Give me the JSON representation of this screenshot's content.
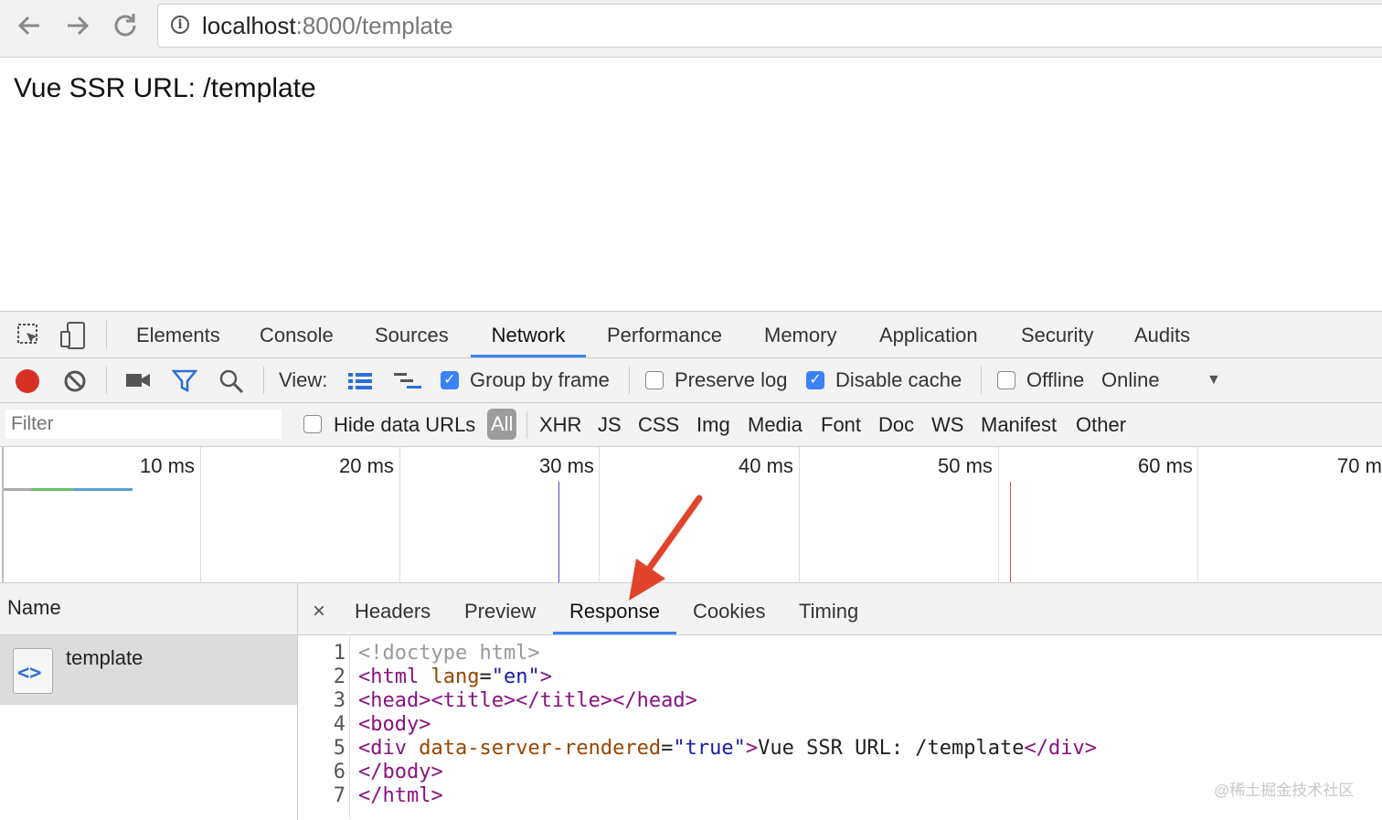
{
  "browser": {
    "url_host": "localhost",
    "url_path": ":8000/template",
    "back_icon": "arrow-left-icon",
    "forward_icon": "arrow-right-icon",
    "reload_icon": "reload-icon"
  },
  "page": {
    "heading": "Vue SSR URL: /template"
  },
  "devtools": {
    "tabs": [
      "Elements",
      "Console",
      "Sources",
      "Network",
      "Performance",
      "Memory",
      "Application",
      "Security",
      "Audits"
    ],
    "active_tab": "Network",
    "toolbar": {
      "view_label": "View:",
      "group_by_frame": "Group by frame",
      "preserve_log": "Preserve log",
      "disable_cache": "Disable cache",
      "offline": "Offline",
      "throttle": "Online",
      "group_by_frame_checked": true,
      "preserve_log_checked": false,
      "disable_cache_checked": true,
      "offline_checked": false
    },
    "filter": {
      "placeholder": "Filter",
      "hide_data_urls": "Hide data URLs",
      "types": [
        "All",
        "XHR",
        "JS",
        "CSS",
        "Img",
        "Media",
        "Font",
        "Doc",
        "WS",
        "Manifest",
        "Other"
      ],
      "active_type": "All"
    },
    "timeline": {
      "labels": [
        "10 ms",
        "20 ms",
        "30 ms",
        "40 ms",
        "50 ms",
        "60 ms",
        "70 m"
      ]
    },
    "requests": {
      "header": "Name",
      "items": [
        {
          "name": "template"
        }
      ]
    },
    "detail": {
      "close": "×",
      "tabs": [
        "Headers",
        "Preview",
        "Response",
        "Cookies",
        "Timing"
      ],
      "active_tab": "Response",
      "line_numbers": [
        "1",
        "2",
        "3",
        "4",
        "5",
        "6",
        "7"
      ],
      "code": {
        "l1": "<!doctype html>",
        "l2_tag_open": "<html ",
        "l2_attr": "lang",
        "l2_eq": "=",
        "l2_val": "\"en\"",
        "l2_close": ">",
        "l3": "<head><title></title></head>",
        "l4": "<body>",
        "l5_tag_open": "<div ",
        "l5_attr": "data-server-rendered",
        "l5_eq": "=",
        "l5_val": "\"true\"",
        "l5_close": ">",
        "l5_text": "Vue SSR URL: /template",
        "l5_end": "</div>",
        "l6": "</body>",
        "l7": "</html>"
      }
    }
  },
  "watermark": "@稀土掘金技术社区",
  "colors": {
    "accent": "#3b82f6",
    "record": "#d93025",
    "arrow": "#e0442c"
  }
}
